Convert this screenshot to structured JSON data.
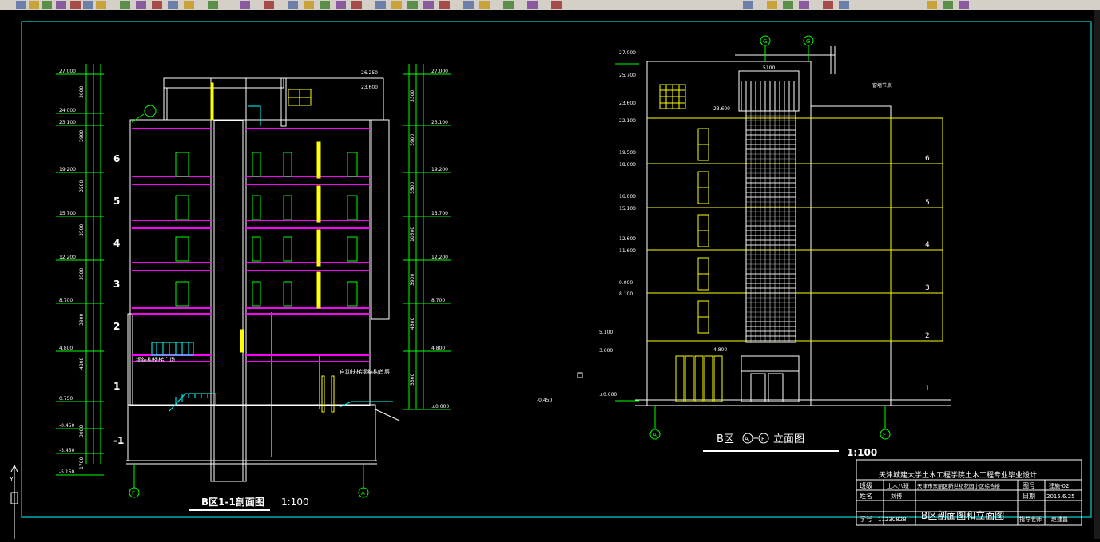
{
  "app": {
    "type": "cad-drawing-viewer"
  },
  "colors": {
    "background": "#000000",
    "frame": "#00ffff",
    "dim": "#00ff00",
    "wall": "#ffffff",
    "floor": "#ff00ff",
    "window": "#ffff00",
    "stair": "#00ffff"
  },
  "section": {
    "title": "B区1-1剖面图",
    "scale": "1:100",
    "axis_left": "F",
    "axis_right": "A",
    "floor_numbers": [
      "6",
      "5",
      "4",
      "3",
      "2",
      "1",
      "-1"
    ],
    "elev_left": [
      "27.000",
      "24.000",
      "23.100",
      "19.200",
      "15.700",
      "12.200",
      "8.700",
      "4.800",
      "0.750",
      "-0.450",
      "-3.450",
      "-5.150"
    ],
    "elev_right": [
      "27.000",
      "23.100",
      "19.200",
      "15.700",
      "12.200",
      "8.700",
      "4.800",
      "±0.000"
    ],
    "dims_left": [
      "3000",
      "3900",
      "3500",
      "3500",
      "3500",
      "3900",
      "4800",
      "3000",
      "1700"
    ],
    "dims_right": [
      "3300",
      "3900",
      "3500",
      "10500",
      "3900",
      "4800",
      "3300"
    ],
    "roof_labels": [
      "26.250",
      "23.600"
    ],
    "label_hall": "钢结构楼梯广场",
    "label_shop": "自动扶梯钢结构首层"
  },
  "elevation": {
    "title": "B区",
    "title_axis_a": "A",
    "title_axis_f": "F",
    "title_suffix": "立面图",
    "scale": "1:100",
    "top_axes": [
      "G",
      "G"
    ],
    "bottom_axes": [
      "A",
      "F"
    ],
    "width_dim": "5100",
    "note": "窗墙节点",
    "floor_numbers": [
      "6",
      "5",
      "4",
      "3",
      "2",
      "1"
    ],
    "elev_labels": [
      "27.000",
      "25.700",
      "23.600",
      "22.100",
      "19.500",
      "18.600",
      "16.000",
      "15.100",
      "12.600",
      "11.600",
      "9.000",
      "8.100",
      "5.100",
      "3.600",
      "±0.000",
      "-0.450"
    ],
    "top_level": "23.600",
    "bottom_level": "4.800"
  },
  "title_block": {
    "school": "天津城建大学土木工程学院土木工程专业毕业设计",
    "class_label": "班级",
    "class_value": "土木八班",
    "name_label": "姓名",
    "name_value": "刘博",
    "id_label": "学号",
    "id_value": "11230828",
    "project": "天津市东丽区新世纪花园小区综合楼",
    "drawing": "B区剖面图和立面图",
    "no_label": "图号",
    "no_value": "建施-02",
    "date_label": "日期",
    "date_value": "2015.6.25",
    "teacher_label": "指导老师",
    "teacher_value": "赵建昌"
  }
}
